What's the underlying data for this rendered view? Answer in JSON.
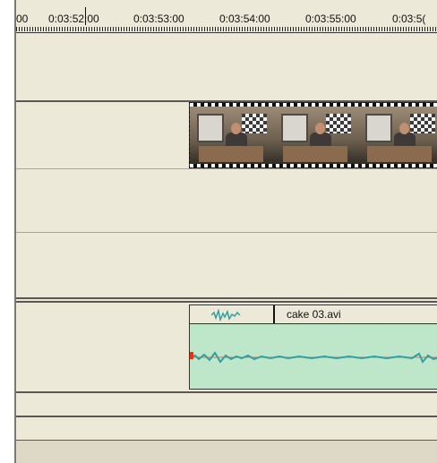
{
  "timeline": {
    "timecodes": [
      "00",
      "0:03:52:00",
      "0:03:53:00",
      "0:03:54:00",
      "0:03:55:00",
      "0:03:5("
    ],
    "playhead_time": "0:03:52:00"
  },
  "tracks": [
    {
      "type": "empty"
    },
    {
      "type": "video",
      "clip_frames": 3
    },
    {
      "type": "empty"
    },
    {
      "type": "empty"
    },
    {
      "type": "audio",
      "clip_name": "cake 03.avi"
    },
    {
      "type": "empty"
    },
    {
      "type": "empty"
    }
  ],
  "colors": {
    "background": "#ece9d8",
    "audio_clip": "#bee7c9",
    "waveform": "#2f9fa3",
    "marker": "#ff2a00"
  }
}
